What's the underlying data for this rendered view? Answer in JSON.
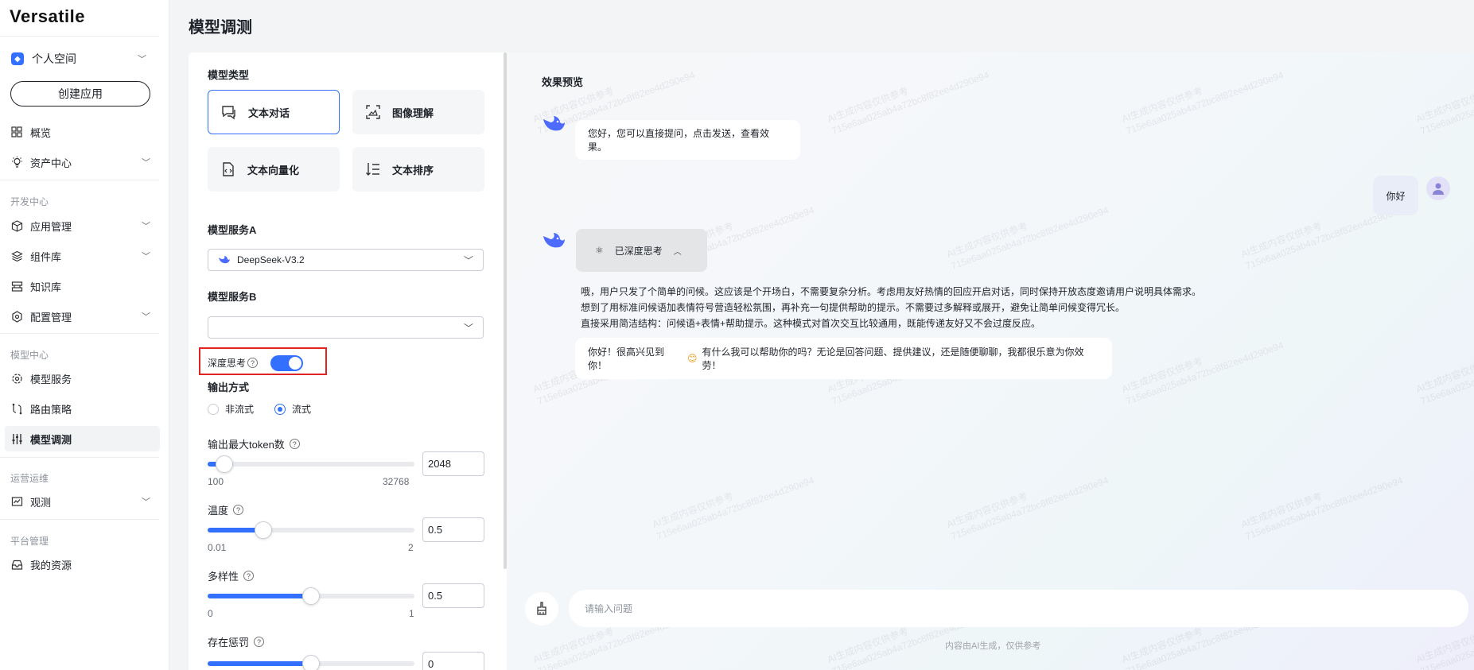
{
  "app": {
    "name": "Versatile"
  },
  "sidebar": {
    "space": {
      "label": "个人空间"
    },
    "create_label": "创建应用",
    "items": [
      {
        "label": "概览"
      },
      {
        "label": "资产中心"
      },
      {
        "label": "应用管理"
      },
      {
        "label": "组件库"
      },
      {
        "label": "知识库"
      },
      {
        "label": "配置管理"
      },
      {
        "label": "模型服务"
      },
      {
        "label": "路由策略"
      },
      {
        "label": "模型调测"
      },
      {
        "label": "观测"
      },
      {
        "label": "我的资源"
      }
    ],
    "sections": [
      "开发中心",
      "模型中心",
      "运营运维",
      "平台管理"
    ]
  },
  "page": {
    "title": "模型调测"
  },
  "config": {
    "model_type_label": "模型类型",
    "model_types": [
      {
        "label": "文本对话",
        "selected": true
      },
      {
        "label": "图像理解",
        "selected": false
      },
      {
        "label": "文本向量化",
        "selected": false
      },
      {
        "label": "文本排序",
        "selected": false
      }
    ],
    "service_a_label": "模型服务A",
    "service_a_value": "DeepSeek-V3.2",
    "service_b_label": "模型服务B",
    "service_b_value": "",
    "deep_think_label": "深度思考",
    "deep_think_on": true,
    "output_mode_label": "输出方式",
    "output_modes": [
      {
        "label": "非流式",
        "checked": false
      },
      {
        "label": "流式",
        "checked": true
      }
    ],
    "params": [
      {
        "label": "输出最大token数",
        "min": "100",
        "max": "32768",
        "value": "2048",
        "fill": 0.08
      },
      {
        "label": "温度",
        "min": "0.01",
        "max": "2",
        "value": "0.5",
        "fill": 0.27
      },
      {
        "label": "多样性",
        "min": "0",
        "max": "1",
        "value": "0.5",
        "fill": 0.5
      },
      {
        "label": "存在惩罚",
        "min": "",
        "max": "",
        "value": "0",
        "fill": 0.5
      }
    ]
  },
  "preview": {
    "title": "效果预览",
    "greeting": "您好，您可以直接提问，点击发送，查看效果。",
    "user_message": "你好",
    "thinking_label": "已深度思考",
    "thinking_lines": [
      "哦，用户只发了个简单的问候。这应该是个开场白，不需要复杂分析。考虑用友好热情的回应开启对话，同时保持开放态度邀请用户说明具体需求。",
      "想到了用标准问候语加表情符号营造轻松氛围，再补充一句提供帮助的提示。不需要过多解释或展开，避免让简单问候变得冗长。",
      "直接采用简洁结构：问候语+表情+帮助提示。这种模式对首次交互比较通用，既能传递友好又不会过度反应。"
    ],
    "answer_before": "你好！很高兴见到你！",
    "answer_emoji": "😊",
    "answer_after": "有什么我可以帮助你的吗？无论是回答问题、提供建议，还是随便聊聊，我都很乐意为你效劳！",
    "input_placeholder": "请输入问题",
    "disclaimer": "内容由AI生成，仅供参考",
    "watermark_line1": "AI生成内容仅供参考",
    "watermark_line2": "715e6aa025ab4a72bc8f82ee4d290e94"
  }
}
